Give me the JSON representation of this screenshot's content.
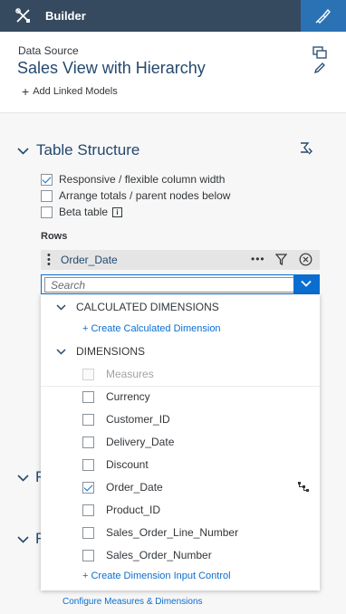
{
  "header": {
    "title": "Builder"
  },
  "data_source": {
    "label": "Data Source",
    "name": "Sales View with Hierarchy",
    "add_linked_models": "Add Linked Models"
  },
  "table_structure": {
    "title": "Table Structure",
    "options": [
      {
        "label": "Responsive / flexible column width",
        "checked": true
      },
      {
        "label": "Arrange totals / parent nodes below",
        "checked": false
      },
      {
        "label": "Beta table",
        "checked": false
      }
    ]
  },
  "rows": {
    "label": "Rows",
    "dimension": "Order_Date",
    "more_glyph": "•••",
    "search_placeholder": "Search"
  },
  "dropdown": {
    "calculated_header": "CALCULATED DIMENSIONS",
    "create_calculated": "+ Create Calculated Dimension",
    "dimensions_header": "DIMENSIONS",
    "items": [
      {
        "label": "Measures",
        "checked": false,
        "disabled": true
      },
      {
        "label": "Currency",
        "checked": false
      },
      {
        "label": "Customer_ID",
        "checked": false
      },
      {
        "label": "Delivery_Date",
        "checked": false
      },
      {
        "label": "Discount",
        "checked": false
      },
      {
        "label": "Order_Date",
        "checked": true
      },
      {
        "label": "Product_ID",
        "checked": false
      },
      {
        "label": "Sales_Order_Line_Number",
        "checked": false
      },
      {
        "label": "Sales_Order_Number",
        "checked": false
      }
    ],
    "create_input_control": "+ Create Dimension Input Control"
  },
  "hidden_sections": [
    {
      "letter": "F"
    },
    {
      "letter": "F"
    }
  ],
  "configure_link": "Configure Measures & Dimensions",
  "colors": {
    "header_bg": "#354a5f",
    "active_tab": "#2a72b4",
    "accent": "#0a6ed1",
    "title_text": "#24496e"
  }
}
